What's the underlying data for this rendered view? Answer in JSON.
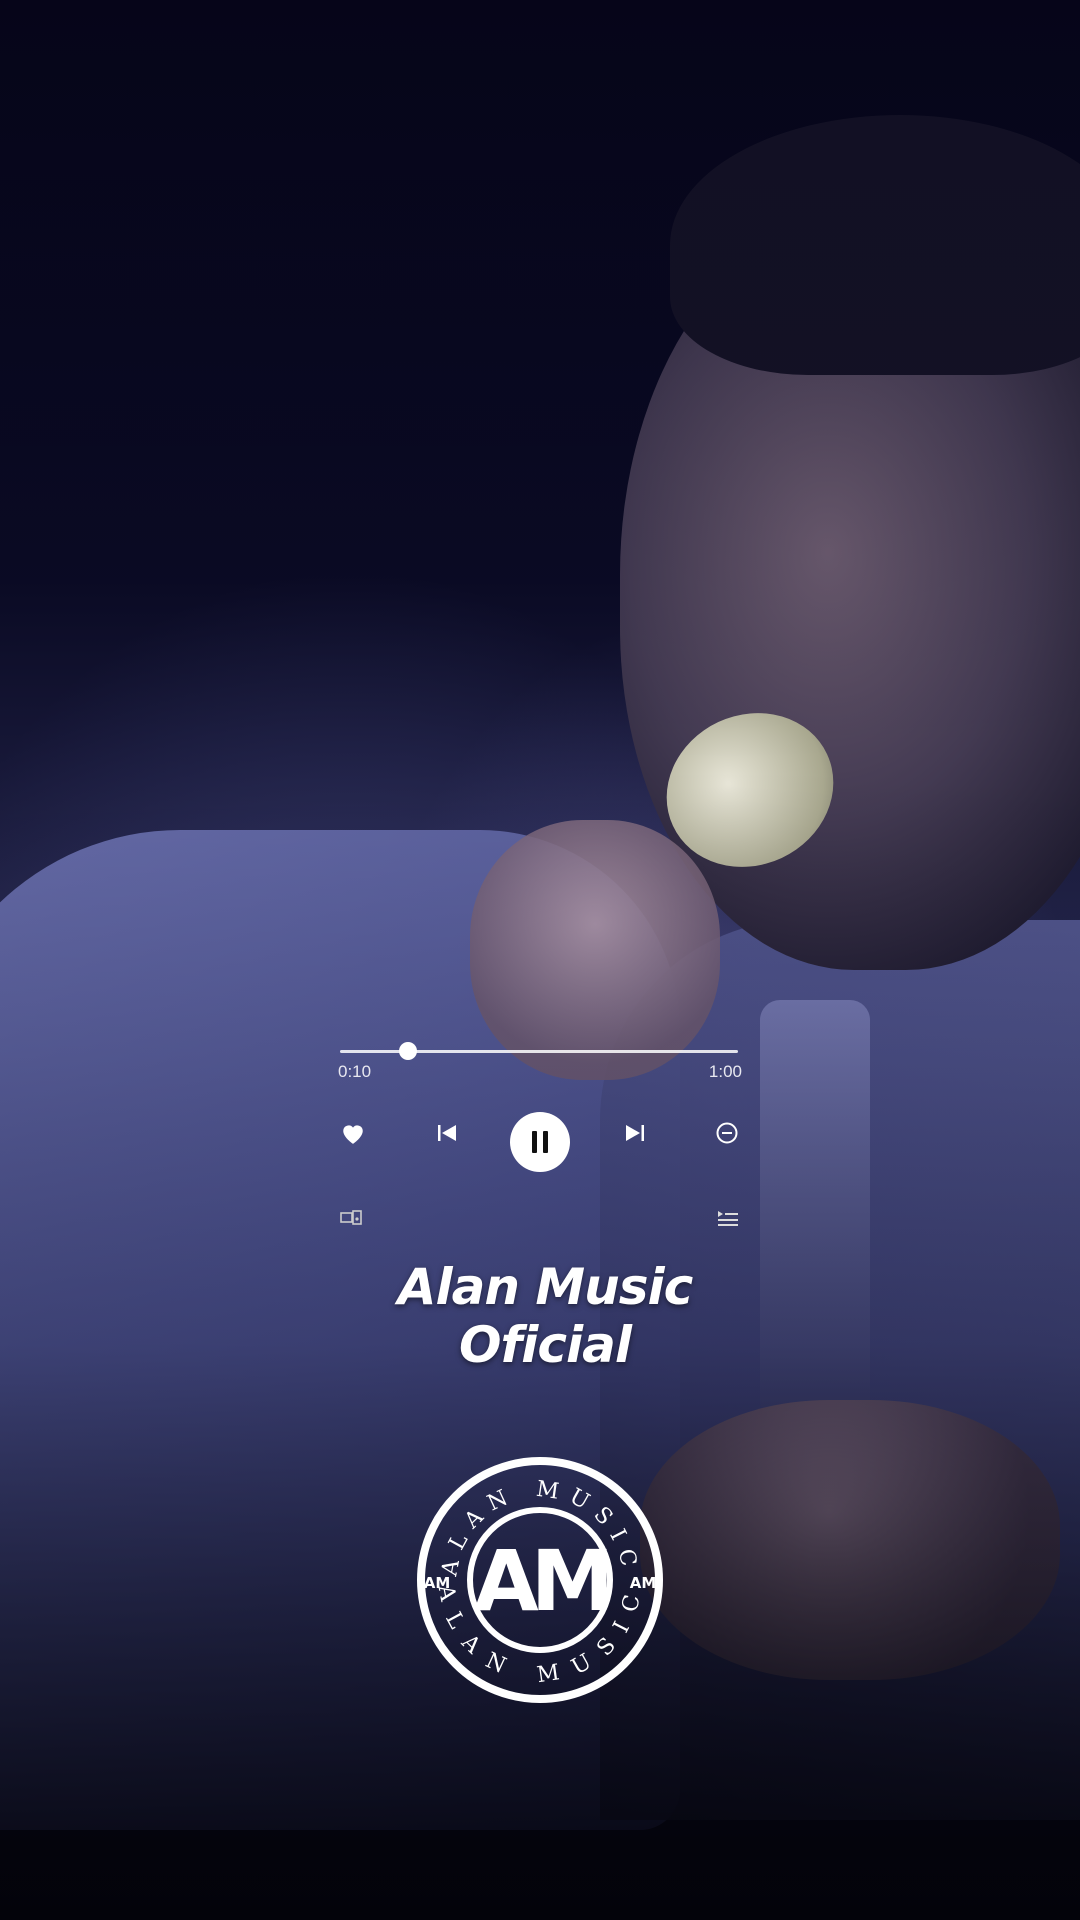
{
  "player": {
    "current_time": "0:10",
    "total_time": "1:00",
    "progress": 0.17
  },
  "brand": {
    "name": "Alan Music Oficial"
  },
  "logo": {
    "ring_text_top": "ALAN MUSIC",
    "ring_text_bottom": "ALAN MUSIC",
    "monogram": "AM",
    "side_mark": "AM"
  },
  "icons": {
    "like": "heart-icon",
    "previous": "skip-previous-icon",
    "play_pause": "pause-icon",
    "next": "skip-next-icon",
    "remove": "minus-circle-icon",
    "devices": "devices-icon",
    "queue": "queue-icon"
  },
  "colors": {
    "background": "#07061a",
    "controls": "#ffffff"
  }
}
